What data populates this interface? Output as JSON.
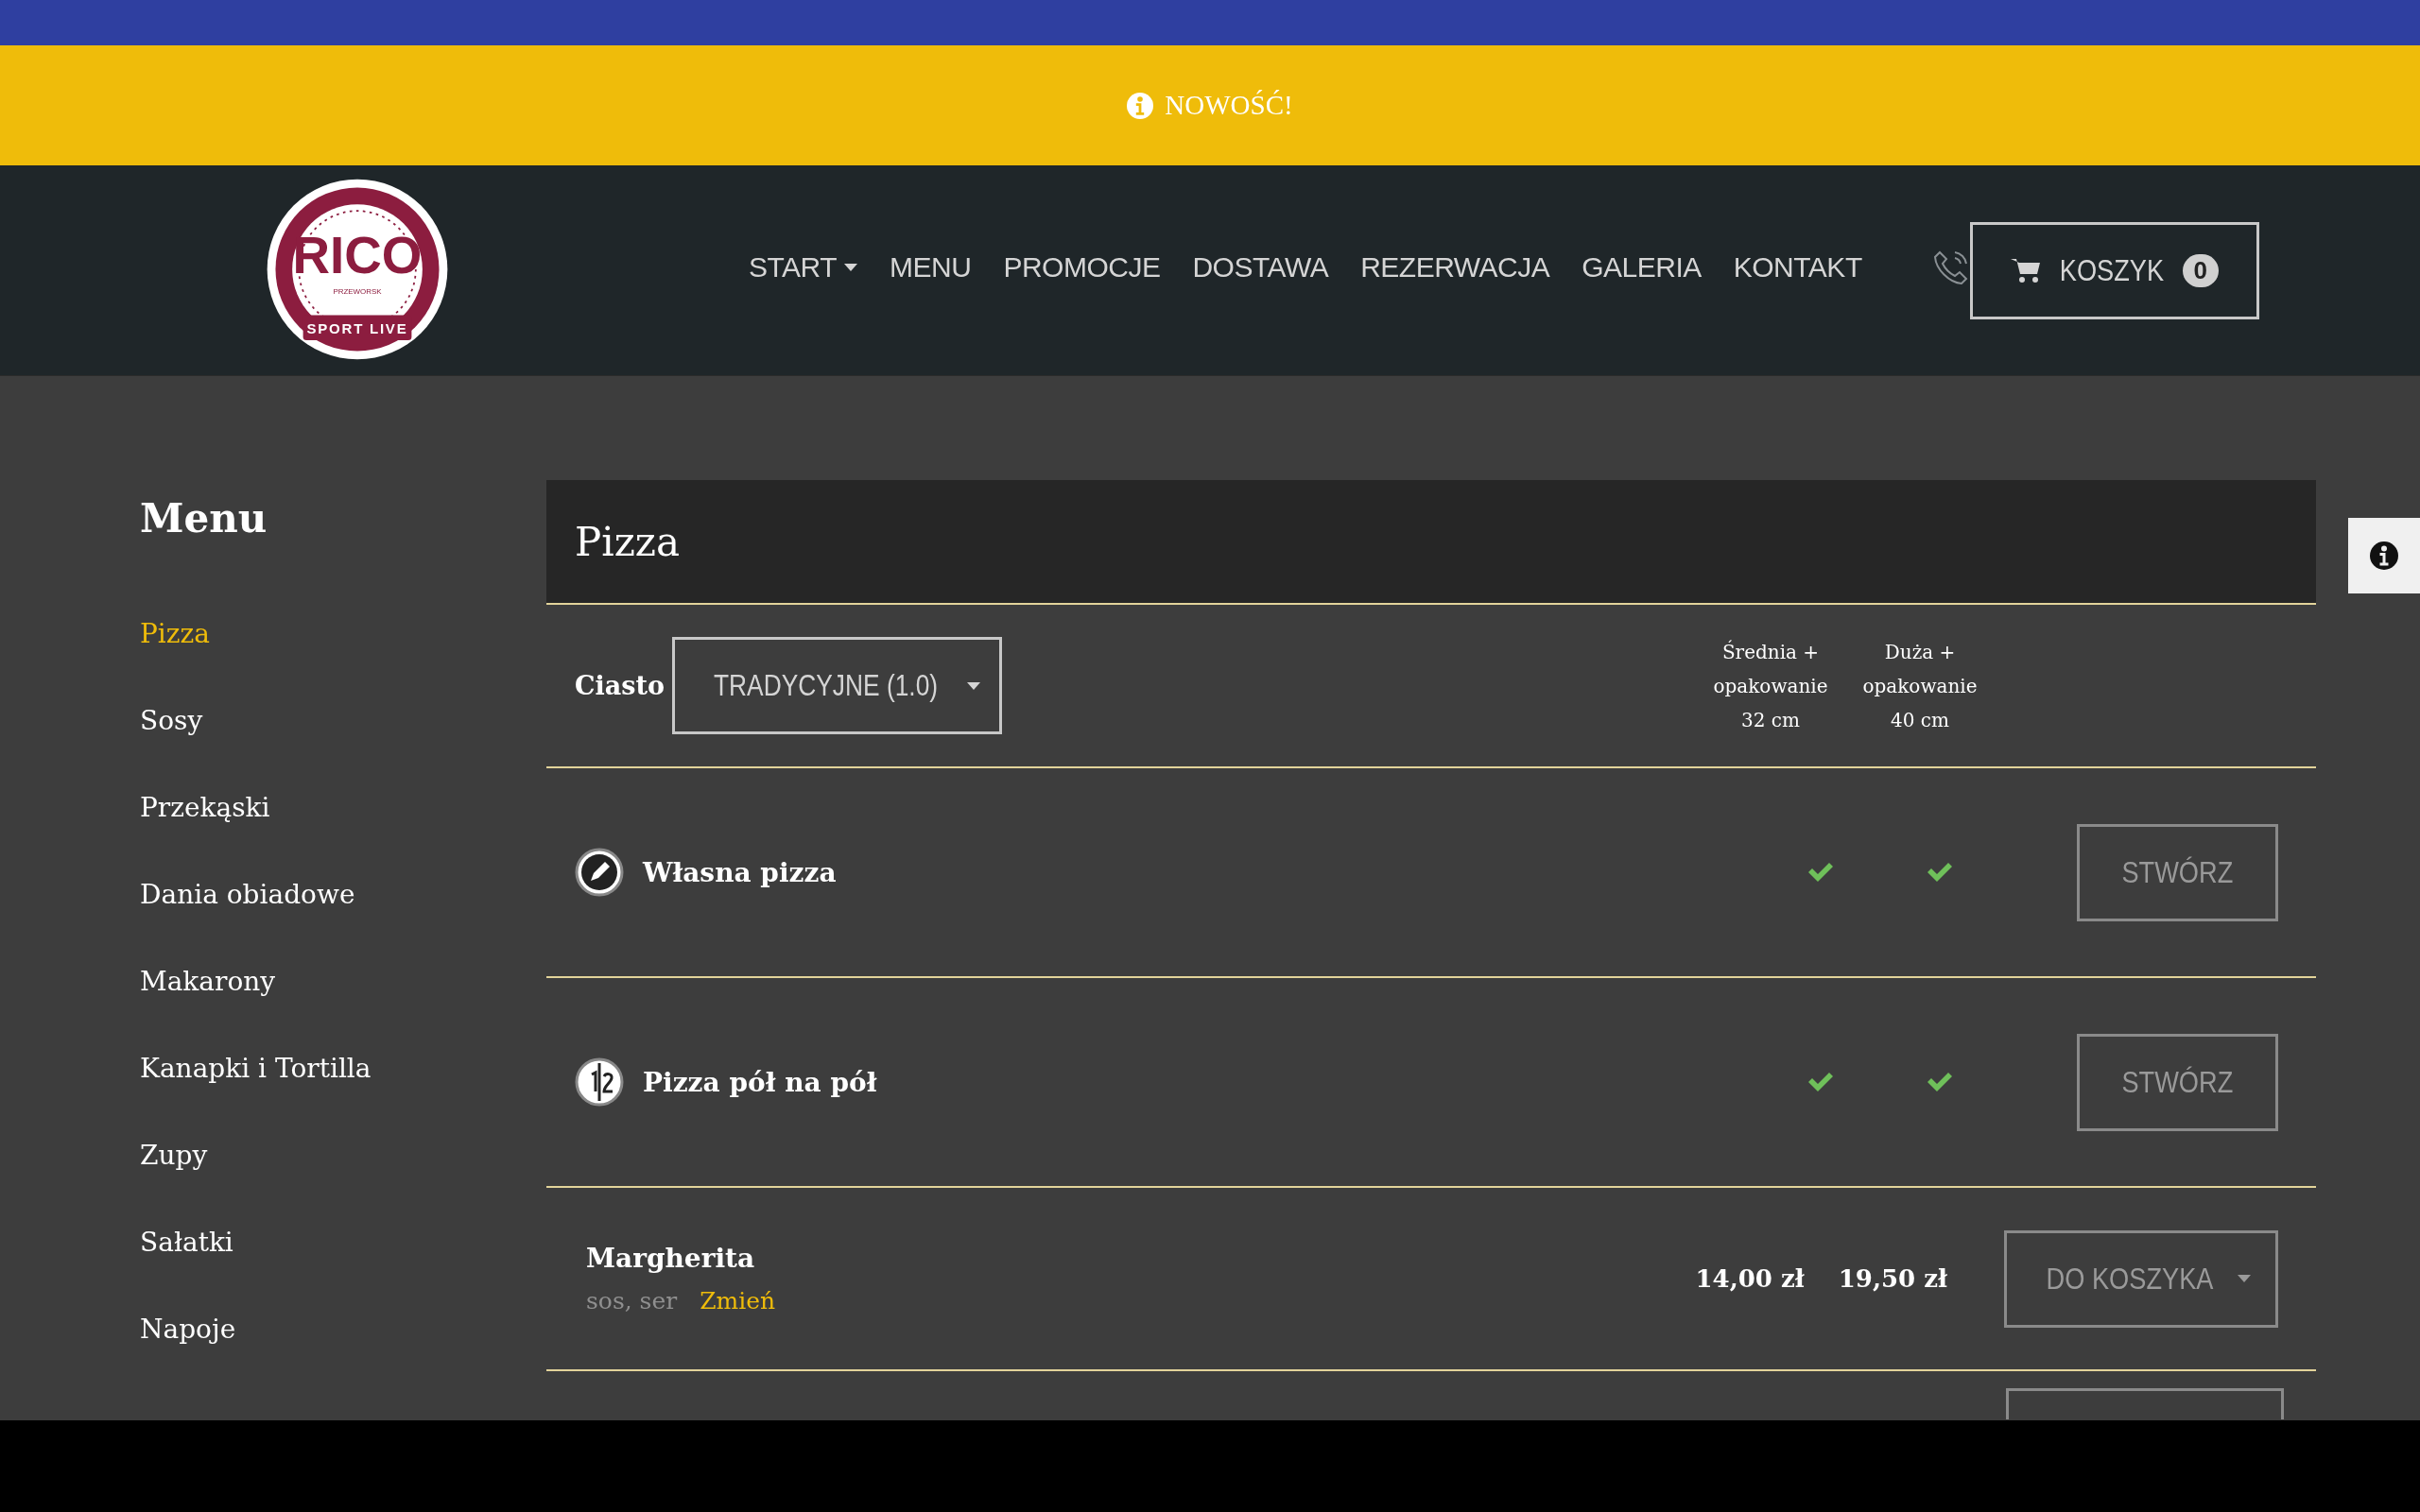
{
  "top_banner": {
    "text": "NOWOŚĆ!"
  },
  "logo": {
    "name": "RICO",
    "place": "PRZEWORSK",
    "tagline": "SPORT LIVE"
  },
  "nav": [
    {
      "label": "START",
      "dropdown": true
    },
    {
      "label": "MENU",
      "dropdown": false
    },
    {
      "label": "PROMOCJE",
      "dropdown": false
    },
    {
      "label": "DOSTAWA",
      "dropdown": false
    },
    {
      "label": "REZERWACJA",
      "dropdown": false
    },
    {
      "label": "GALERIA",
      "dropdown": false
    },
    {
      "label": "KONTAKT",
      "dropdown": false
    }
  ],
  "cart": {
    "label": "KOSZYK",
    "count": "0"
  },
  "sidebar": {
    "title": "Menu",
    "items": [
      {
        "label": "Pizza",
        "selected": true
      },
      {
        "label": "Sosy",
        "selected": false
      },
      {
        "label": "Przekąski",
        "selected": false
      },
      {
        "label": "Dania obiadowe",
        "selected": false
      },
      {
        "label": "Makarony",
        "selected": false
      },
      {
        "label": "Kanapki i Tortilla",
        "selected": false
      },
      {
        "label": "Zupy",
        "selected": false
      },
      {
        "label": "Sałatki",
        "selected": false
      },
      {
        "label": "Napoje",
        "selected": false
      }
    ]
  },
  "menu": {
    "title": "Pizza",
    "dough_label": "Ciasto",
    "dough_select": "TRADYCYJNE (1.0)",
    "size_columns": [
      "Średnia + opakowanie 32 cm",
      "Duża + opakowanie 40 cm"
    ],
    "rows": [
      {
        "kind": "custom",
        "name": "Własna pizza",
        "sizes": [
          true,
          true
        ],
        "button": "STWÓRZ"
      },
      {
        "kind": "halves",
        "name": "Pizza pół na pół",
        "sizes": [
          true,
          true
        ],
        "button": "STWÓRZ"
      },
      {
        "kind": "product",
        "name": "Margherita",
        "ingredients": "sos, ser",
        "change": "Zmień",
        "prices": [
          "14,00 zł",
          "19,50 zł"
        ],
        "button": "DO KOSZYKA",
        "dropdown": true
      },
      {
        "kind": "cut"
      }
    ]
  }
}
